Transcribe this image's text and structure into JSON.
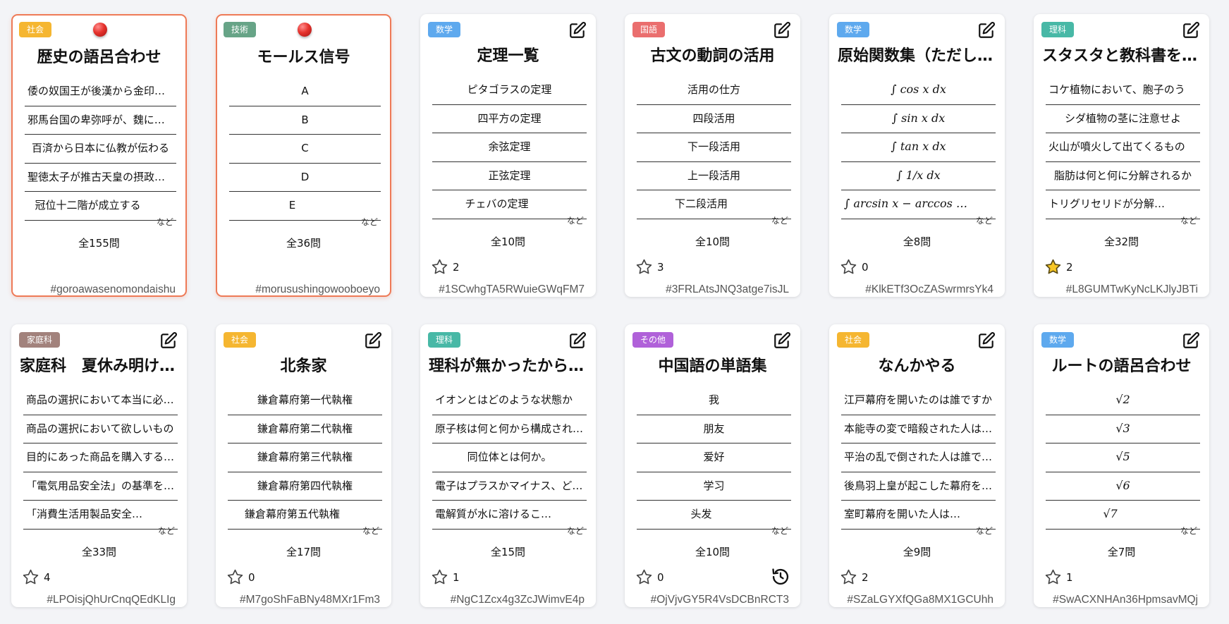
{
  "colors": {
    "社会": "#f5b631",
    "技術": "#67a487",
    "数学": "#5ea9ee",
    "国語": "#ea6e6e",
    "理科": "#48b8a6",
    "家庭科": "#a2827c",
    "その他": "#b061d9",
    "selected_border": "#ee7a57"
  },
  "cards": [
    {
      "tag": "社会",
      "tag_color": "#f5b631",
      "title": "歴史の語呂合わせ",
      "title_align": "center",
      "items": [
        {
          "text": "倭の奴国王が後漢から金印を授かる",
          "align": "l"
        },
        {
          "text": "邪馬台国の卑弥呼が、魏に使いを送る",
          "align": "l"
        },
        {
          "text": "百済から日本に仏教が伝わる",
          "align": "c"
        },
        {
          "text": "聖徳太子が推古天皇の摂政となる",
          "align": "l"
        },
        {
          "text": "冠位十二階が成立する",
          "align": "c"
        }
      ],
      "nado": "など",
      "total": "全155問",
      "hash": "#goroawasenomondaishu",
      "selected": true,
      "pinned": true
    },
    {
      "tag": "技術",
      "tag_color": "#67a487",
      "title": "モールス信号",
      "title_align": "center",
      "items": [
        {
          "text": "A",
          "align": "c"
        },
        {
          "text": "B",
          "align": "c"
        },
        {
          "text": "C",
          "align": "c"
        },
        {
          "text": "D",
          "align": "c"
        },
        {
          "text": "E",
          "align": "c"
        }
      ],
      "nado": "など",
      "total": "全36問",
      "hash": "#morusushingowooboeyo",
      "selected": true,
      "pinned": true
    },
    {
      "tag": "数学",
      "tag_color": "#5ea9ee",
      "title": "定理一覧",
      "title_align": "center",
      "items": [
        {
          "text": "ピタゴラスの定理",
          "align": "c"
        },
        {
          "text": "四平方の定理",
          "align": "c"
        },
        {
          "text": "余弦定理",
          "align": "c"
        },
        {
          "text": "正弦定理",
          "align": "c"
        },
        {
          "text": "チェバの定理",
          "align": "c"
        }
      ],
      "nado": "など",
      "total": "全10問",
      "star": "outline",
      "count": "2",
      "hash": "#1SCwhgTA5RWuieGWqFM7"
    },
    {
      "tag": "国語",
      "tag_color": "#ea6e6e",
      "title": "古文の動詞の活用",
      "title_align": "center",
      "items": [
        {
          "text": "活用の仕方",
          "align": "c"
        },
        {
          "text": "四段活用",
          "align": "c"
        },
        {
          "text": "下一段活用",
          "align": "c"
        },
        {
          "text": "上一段活用",
          "align": "c"
        },
        {
          "text": "下二段活用",
          "align": "c"
        }
      ],
      "nado": "など",
      "total": "全10問",
      "star": "outline",
      "count": "3",
      "hash": "#3FRLAtsJNQ3atge7isJL"
    },
    {
      "tag": "数学",
      "tag_color": "#5ea9ee",
      "title": "原始関数集（ただし積分定数は省略）",
      "title_align": "left",
      "items": [
        {
          "text": "∫ cos x dx",
          "align": "c",
          "math": true
        },
        {
          "text": "∫ sin x dx",
          "align": "c",
          "math": true
        },
        {
          "text": "∫ tan x dx",
          "align": "c",
          "math": true
        },
        {
          "text": "∫ 1/x dx",
          "align": "c",
          "math": true
        },
        {
          "text": "∫ arcsin x − arccos x + arctan x dx",
          "align": "l",
          "math": true
        }
      ],
      "nado": "など",
      "total": "全8問",
      "star": "outline",
      "count": "0",
      "hash": "#KlkETf3OcZASwrmrsYk4"
    },
    {
      "tag": "理科",
      "tag_color": "#48b8a6",
      "title": "スタスタと教科書を覚えよう",
      "title_align": "left",
      "items": [
        {
          "text": "コケ植物において、胞子のう",
          "align": "l"
        },
        {
          "text": "シダ植物の茎に注意せよ",
          "align": "c"
        },
        {
          "text": "火山が噴火して出てくるもの",
          "align": "l"
        },
        {
          "text": "脂肪は何と何に分解されるか",
          "align": "c"
        },
        {
          "text": "トリグリセリドが分解されると",
          "align": "l"
        }
      ],
      "nado": "など",
      "total": "全32問",
      "star": "filled",
      "count": "2",
      "hash": "#L8GUMTwKyNcLKJlyJBTi"
    },
    {
      "tag": "家庭科",
      "tag_color": "#a2827c",
      "title": "家庭科　夏休み明けテスト",
      "title_align": "left",
      "items": [
        {
          "text": "商品の選択において本当に必要か",
          "align": "l"
        },
        {
          "text": "商品の選択において欲しいもの",
          "align": "l"
        },
        {
          "text": "目的にあった商品を購入すること",
          "align": "l"
        },
        {
          "text": "「電気用品安全法」の基準を満たす",
          "align": "l"
        },
        {
          "text": "「消費生活用製品安全法」の基準",
          "align": "l"
        }
      ],
      "nado": "など",
      "total": "全33問",
      "star": "outline",
      "count": "4",
      "hash": "#LPOisjQhUrCnqQEdKLIg"
    },
    {
      "tag": "社会",
      "tag_color": "#f5b631",
      "title": "北条家",
      "title_align": "center",
      "items": [
        {
          "text": "鎌倉幕府第一代執権",
          "align": "c"
        },
        {
          "text": "鎌倉幕府第二代執権",
          "align": "c"
        },
        {
          "text": "鎌倉幕府第三代執権",
          "align": "c"
        },
        {
          "text": "鎌倉幕府第四代執権",
          "align": "c"
        },
        {
          "text": "鎌倉幕府第五代執権",
          "align": "c"
        }
      ],
      "nado": "など",
      "total": "全17問",
      "star": "outline",
      "count": "0",
      "hash": "#M7goShFaBNy48MXr1Fm3"
    },
    {
      "tag": "理科",
      "tag_color": "#48b8a6",
      "title": "理科が無かったから作りました",
      "title_align": "left",
      "items": [
        {
          "text": "イオンとはどのような状態か",
          "align": "l"
        },
        {
          "text": "原子核は何と何から構成されるか",
          "align": "l"
        },
        {
          "text": "同位体とは何か。",
          "align": "c"
        },
        {
          "text": "電子はプラスかマイナス、どちらか",
          "align": "l"
        },
        {
          "text": "電解質が水に溶けることを何という",
          "align": "l"
        }
      ],
      "nado": "など",
      "total": "全15問",
      "star": "outline",
      "count": "1",
      "hash": "#NgC1Zcx4g3ZcJWimvE4p"
    },
    {
      "tag": "その他",
      "tag_color": "#b061d9",
      "title": "中国語の単語集",
      "title_align": "center",
      "items": [
        {
          "text": "我",
          "align": "c"
        },
        {
          "text": "朋友",
          "align": "c"
        },
        {
          "text": "爱好",
          "align": "c"
        },
        {
          "text": "学习",
          "align": "c"
        },
        {
          "text": "头发",
          "align": "c"
        }
      ],
      "nado": "など",
      "total": "全10問",
      "star": "outline",
      "count": "0",
      "history": true,
      "hash": "#OjVjvGY5R4VsDCBnRCT3"
    },
    {
      "tag": "社会",
      "tag_color": "#f5b631",
      "title": "なんかやる",
      "title_align": "center",
      "items": [
        {
          "text": "江戸幕府を開いたのは誰ですか",
          "align": "l"
        },
        {
          "text": "本能寺の変で暗殺された人は誰か",
          "align": "l"
        },
        {
          "text": "平治の乱で倒された人は誰ですか",
          "align": "l"
        },
        {
          "text": "後鳥羽上皇が起こした幕府を倒す",
          "align": "l"
        },
        {
          "text": "室町幕府を開いた人は誰ですか",
          "align": "l"
        }
      ],
      "nado": "など",
      "total": "全9問",
      "star": "outline",
      "count": "2",
      "hash": "#SZaLGYXfQGa8MX1GCUhh"
    },
    {
      "tag": "数学",
      "tag_color": "#5ea9ee",
      "title": "ルートの語呂合わせ",
      "title_align": "center",
      "items": [
        {
          "text": "√2",
          "align": "c",
          "math": true
        },
        {
          "text": "√3",
          "align": "c",
          "math": true
        },
        {
          "text": "√5",
          "align": "c",
          "math": true
        },
        {
          "text": "√6",
          "align": "c",
          "math": true
        },
        {
          "text": "√7",
          "align": "c",
          "math": true
        }
      ],
      "nado": "など",
      "total": "全7問",
      "star": "outline",
      "count": "1",
      "hash": "#SwACXNHAn36HpmsavMQj"
    }
  ]
}
